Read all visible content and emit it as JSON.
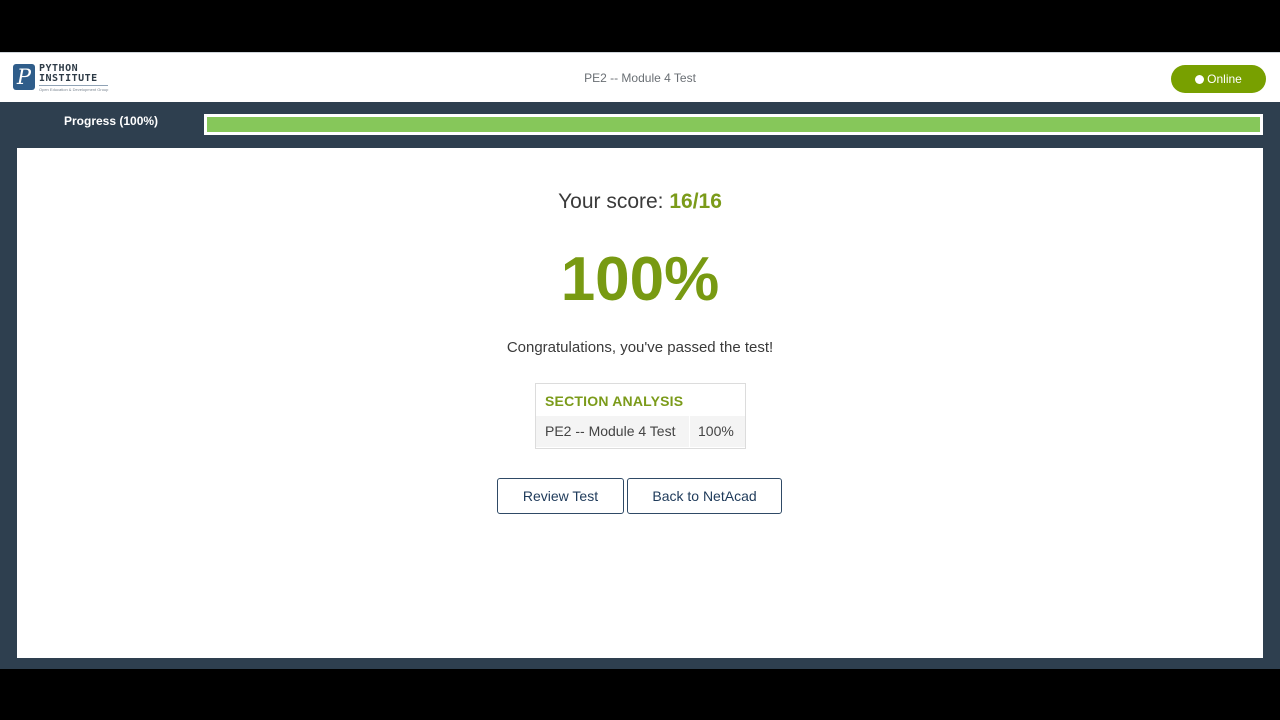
{
  "header": {
    "logo_line1": "PYTHON",
    "logo_line2": "INSTITUTE",
    "logo_tagline": "Open Education & Development Group",
    "logo_mark": "P",
    "title": "PE2 -- Module 4 Test",
    "status_label": "Online"
  },
  "progress": {
    "label": "Progress (100%)",
    "value": 1.0
  },
  "result": {
    "score_prefix": "Your score:",
    "score_value": "16/16",
    "percent": "100%",
    "message": "Congratulations, you've passed the test!"
  },
  "section_analysis": {
    "heading": "SECTION ANALYSIS",
    "rows": [
      {
        "name": "PE2 -- Module 4 Test",
        "score": "100%"
      }
    ]
  },
  "actions": {
    "review_label": "Review Test",
    "back_label": "Back to NetAcad"
  },
  "colors": {
    "accent_green": "#789a12",
    "progress_fill": "#86c75a",
    "frame": "#2e3f4f",
    "button_text": "#1e3a5a"
  },
  "icons": {
    "status": "online-dot-icon",
    "logo": "python-institute-logo"
  }
}
